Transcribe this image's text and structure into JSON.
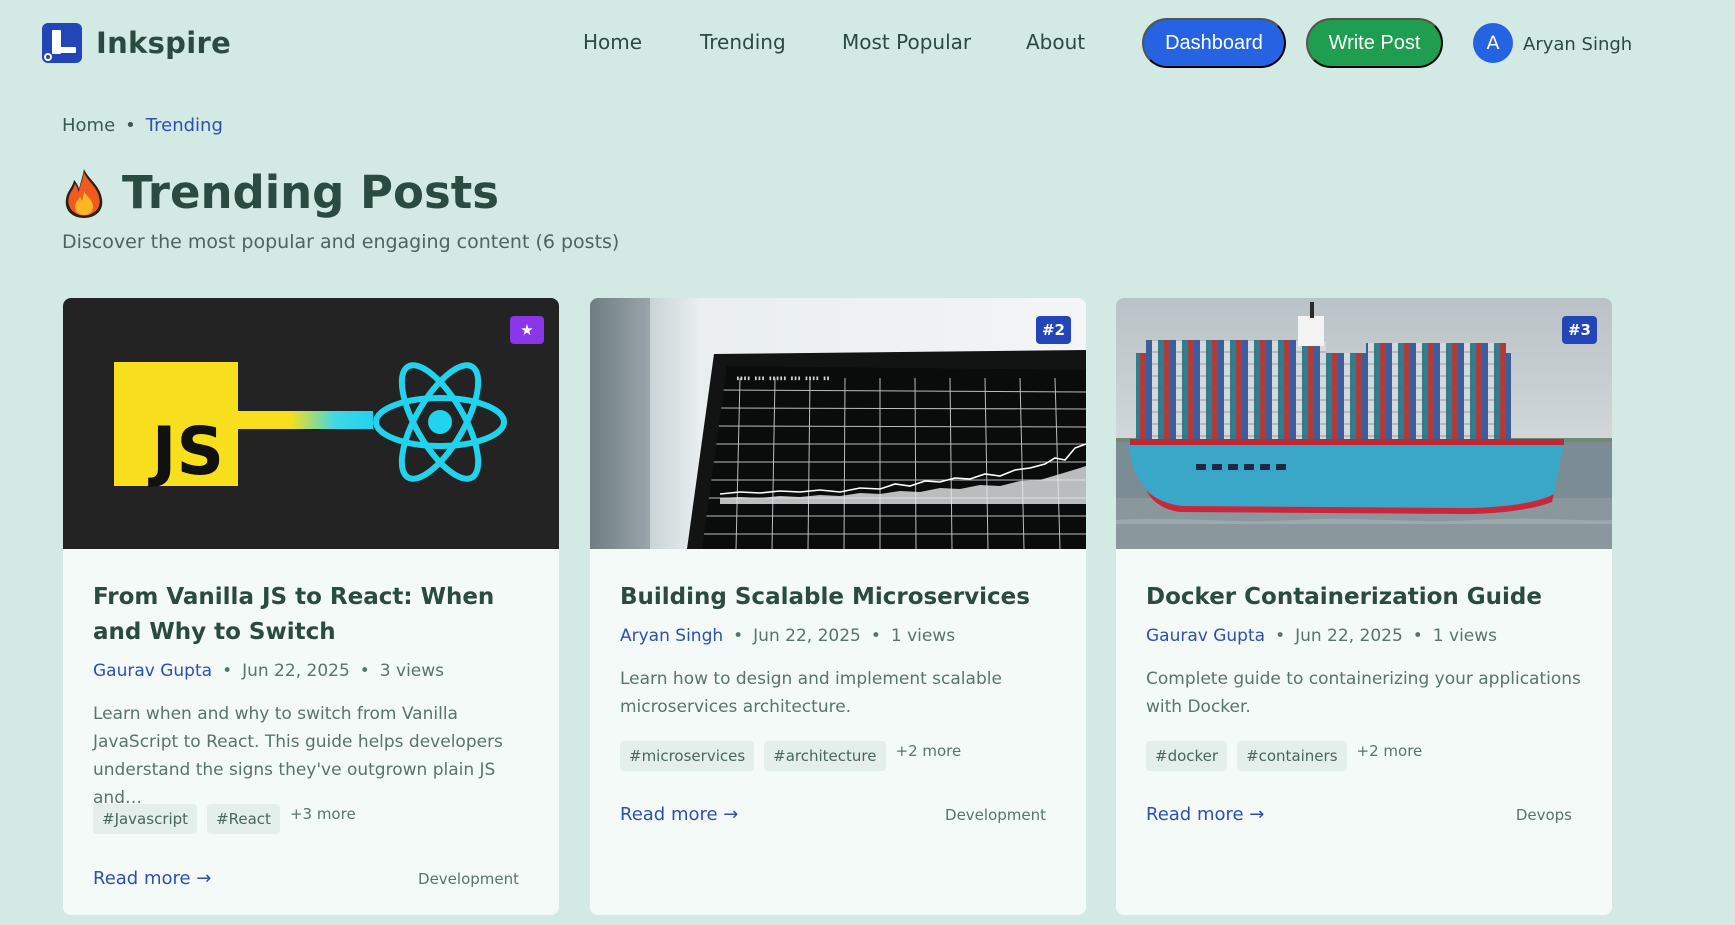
{
  "brand": {
    "name": "Inkspire"
  },
  "nav": {
    "home": "Home",
    "trending": "Trending",
    "most_popular": "Most Popular",
    "about": "About"
  },
  "actions": {
    "dashboard": "Dashboard",
    "write_post": "Write Post"
  },
  "user": {
    "initial": "A",
    "name": "Aryan Singh"
  },
  "breadcrumb": {
    "home": "Home",
    "separator": "•",
    "current": "Trending"
  },
  "page": {
    "title": "Trending Posts",
    "subtitle": "Discover the most popular and engaging content (6 posts)"
  },
  "colors": {
    "background": "#d3e9e3",
    "primary": "#2563e2",
    "success": "#1f9e4f",
    "featured": "#8a36e8",
    "rank": "#2345b8"
  },
  "posts": [
    {
      "badge": "★",
      "image": "javascript-to-react-illustration",
      "title": "From Vanilla JS to React: When and Why to Switch",
      "author": "Gaurav Gupta",
      "date": "Jun 22, 2025",
      "views": "3 views",
      "excerpt": "Learn when and why to switch from Vanilla JavaScript to React. This guide helps developers understand the signs they've outgrown plain JS and…",
      "tags": [
        "#Javascript",
        "#React"
      ],
      "more": "+3 more",
      "read_more": "Read more →",
      "category": "Development"
    },
    {
      "badge": "#2",
      "image": "monitor-with-chart-photo",
      "title": "Building Scalable Microservices",
      "author": "Aryan Singh",
      "date": "Jun 22, 2025",
      "views": "1 views",
      "excerpt": "Learn how to design and implement scalable microservices architecture.",
      "tags": [
        "#microservices",
        "#architecture"
      ],
      "more": "+2 more",
      "read_more": "Read more →",
      "category": "Development"
    },
    {
      "badge": "#3",
      "image": "container-ship-photo",
      "title": "Docker Containerization Guide",
      "author": "Gaurav Gupta",
      "date": "Jun 22, 2025",
      "views": "1 views",
      "excerpt": "Complete guide to containerizing your applications with Docker.",
      "tags": [
        "#docker",
        "#containers"
      ],
      "more": "+2 more",
      "read_more": "Read more →",
      "category": "Devops"
    }
  ]
}
